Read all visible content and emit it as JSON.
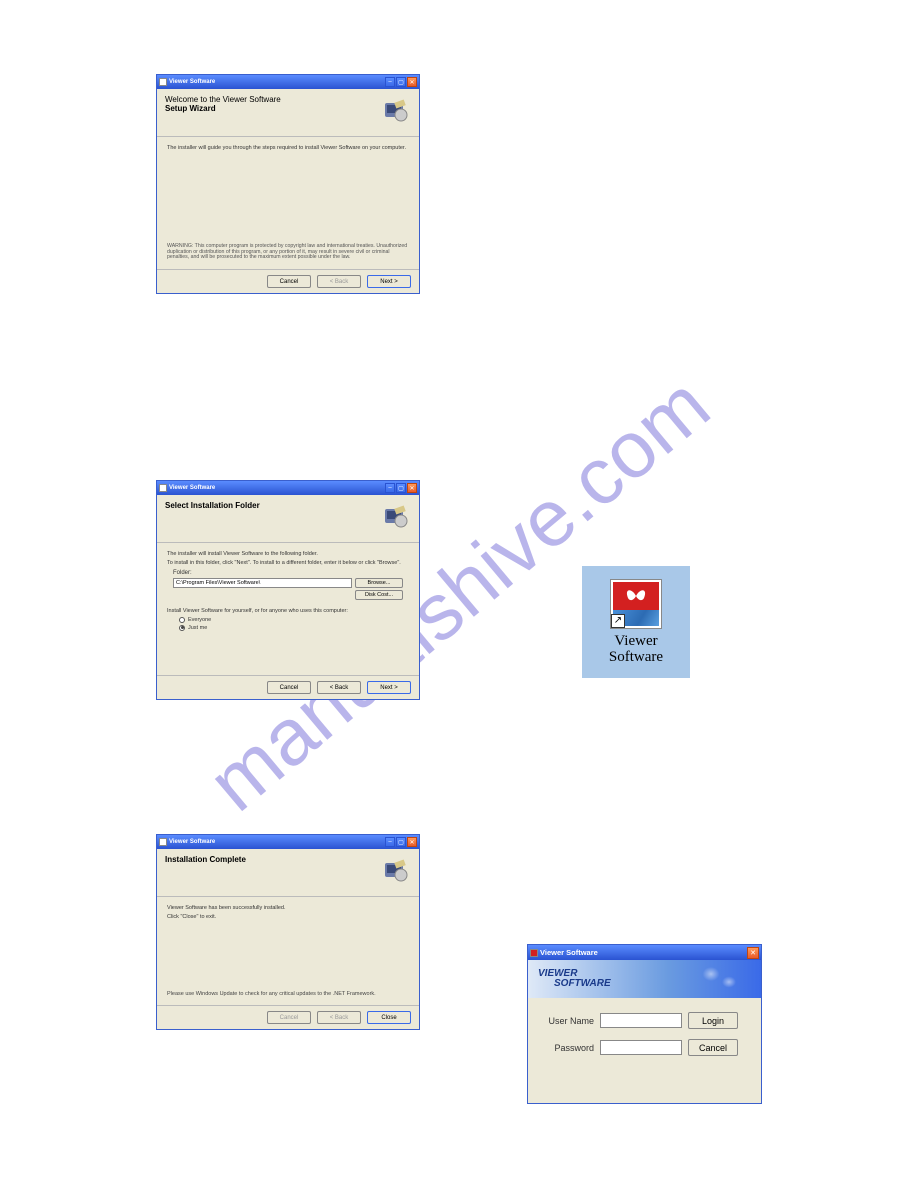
{
  "watermark": "manualshive.com",
  "installer_title": "Viewer Software",
  "win1": {
    "header_line1": "Welcome to the Viewer Software",
    "header_line2": "Setup Wizard",
    "body": "The installer will guide you through the steps required to install Viewer Software on your computer.",
    "warning": "WARNING: This computer program is protected by copyright law and international treaties. Unauthorized duplication or distribution of this program, or any portion of it, may result in severe civil or criminal penalties, and will be prosecuted to the maximum extent possible under the law.",
    "btn_cancel": "Cancel",
    "btn_back": "< Back",
    "btn_next": "Next >"
  },
  "win2": {
    "header": "Select Installation Folder",
    "body1": "The installer will install Viewer Software to the following folder.",
    "body2": "To install in this folder, click \"Next\". To install to a different folder, enter it below or click \"Browse\".",
    "folder_label": "Folder:",
    "folder_value": "C:\\Program Files\\Viewer Software\\",
    "btn_browse": "Browse...",
    "btn_diskcost": "Disk Cost...",
    "install_for": "Install Viewer Software for yourself, or for anyone who uses this computer:",
    "opt_everyone": "Everyone",
    "opt_justme": "Just me",
    "btn_cancel": "Cancel",
    "btn_back": "< Back",
    "btn_next": "Next >"
  },
  "win3": {
    "header": "Installation Complete",
    "body1": "Viewer Software has been successfully installed.",
    "body2": "Click \"Close\" to exit.",
    "note": "Please use Windows Update to check for any critical updates to the .NET Framework.",
    "btn_cancel": "Cancel",
    "btn_back": "< Back",
    "btn_close": "Close"
  },
  "desktop_icon": {
    "label_line1": "Viewer",
    "label_line2": "Software"
  },
  "login": {
    "title": "Viewer Software",
    "banner_line1": "VIEWER",
    "banner_line2": "SOFTWARE",
    "username_label": "User Name",
    "password_label": "Password",
    "btn_login": "Login",
    "btn_cancel": "Cancel"
  }
}
